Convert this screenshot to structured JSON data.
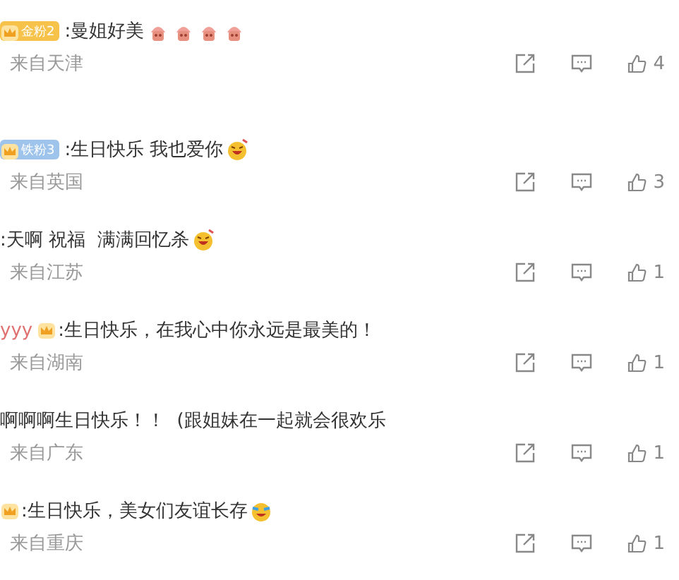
{
  "comments": [
    {
      "badge": {
        "text": "金粉2",
        "kind": "gold"
      },
      "text": ":曼姐好美",
      "emojis": [
        {
          "kind": "pink"
        },
        {
          "kind": "pink"
        },
        {
          "kind": "pink"
        },
        {
          "kind": "pink"
        }
      ],
      "location": "来自天津",
      "likes": "4"
    },
    {
      "badge": {
        "text": "铁粉3",
        "kind": "iron"
      },
      "text": ":生日快乐 我也爱你",
      "emojis": [
        {
          "kind": "laugh"
        }
      ],
      "location": "来自英国",
      "likes": "3"
    },
    {
      "text": ":天啊 祝福  满满回忆杀",
      "emojis": [
        {
          "kind": "laugh"
        }
      ],
      "location": "来自江苏",
      "likes": "1"
    },
    {
      "username": "yyy",
      "crown": true,
      "text": ":生日快乐，在我心中你永远是最美的！",
      "location": "来自湖南",
      "likes": "1"
    },
    {
      "text": "啊啊啊生日快乐！！  (跟姐妹在一起就会很欢乐",
      "location": "来自广东",
      "likes": "1"
    },
    {
      "crown": true,
      "text": ":生日快乐，美女们友谊长存",
      "emojis": [
        {
          "kind": "cry-laugh"
        }
      ],
      "location": "来自重庆",
      "likes": "1"
    }
  ]
}
